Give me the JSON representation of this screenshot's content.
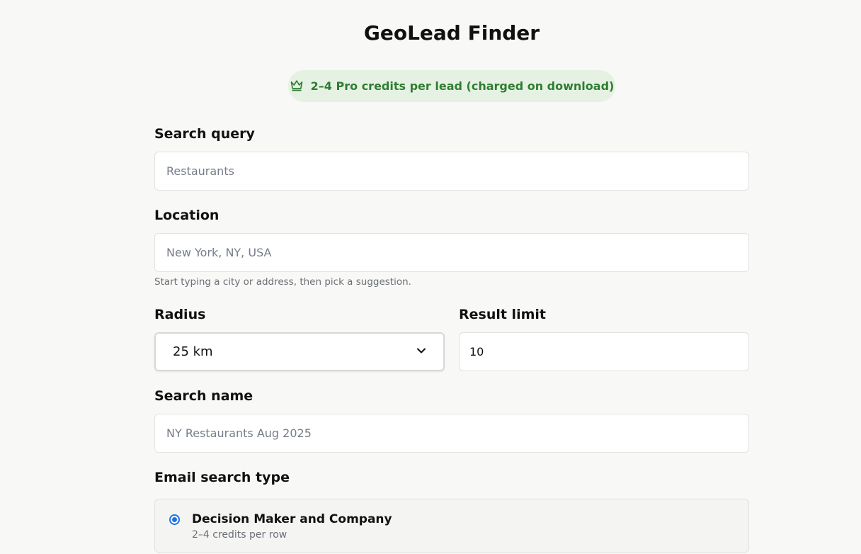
{
  "page": {
    "title": "GeoLead Finder"
  },
  "badge": {
    "icon": "crown-icon",
    "text": "2–4 Pro credits per lead (charged on download)",
    "color": "#2f7d32",
    "background": "#e5f2e3"
  },
  "form": {
    "search_query": {
      "label": "Search query",
      "placeholder": "Restaurants",
      "value": ""
    },
    "location": {
      "label": "Location",
      "placeholder": "New York, NY, USA",
      "value": "",
      "hint": "Start typing a city or address, then pick a suggestion."
    },
    "radius": {
      "label": "Radius",
      "selected": "25 km"
    },
    "result_limit": {
      "label": "Result limit",
      "value": "10"
    },
    "search_name": {
      "label": "Search name",
      "placeholder": "NY Restaurants Aug 2025",
      "value": ""
    },
    "email_search_type": {
      "label": "Email search type",
      "options": [
        {
          "title": "Decision Maker and Company",
          "subtitle": "2–4 credits per row",
          "selected": true
        }
      ]
    }
  },
  "colors": {
    "accent": "#1a73e8",
    "background": "#f8f8f6"
  }
}
